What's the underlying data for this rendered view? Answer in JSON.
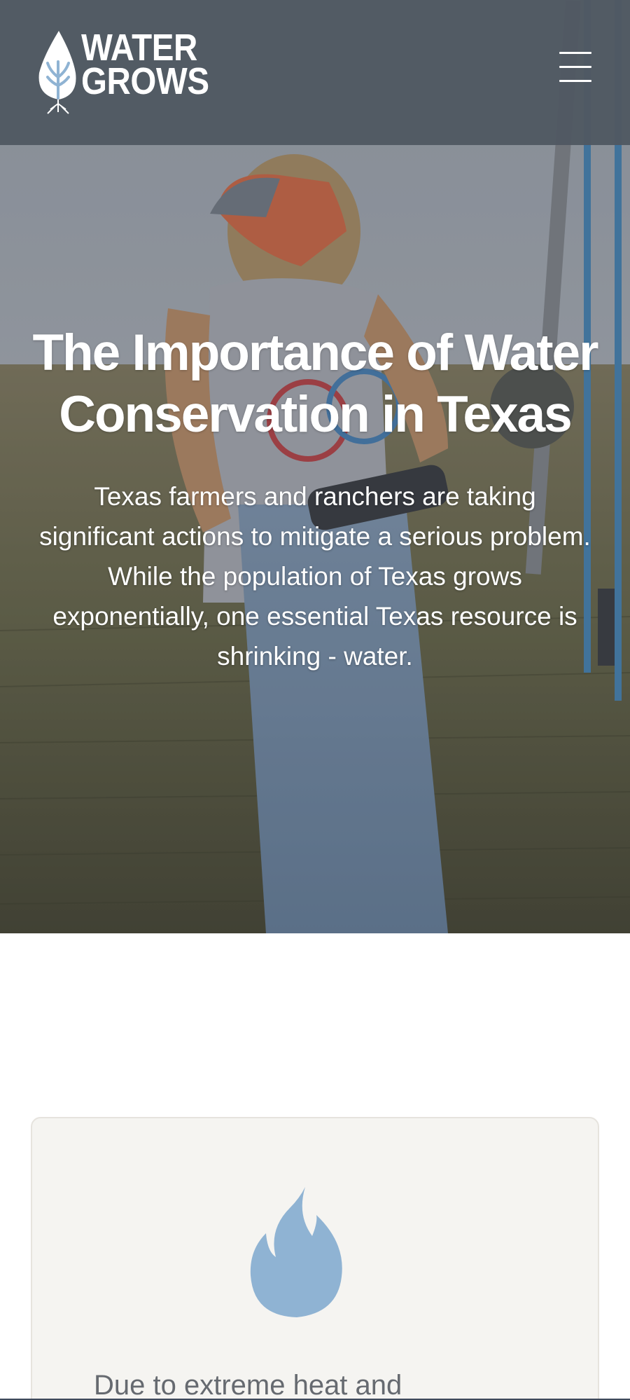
{
  "header": {
    "logo_line1": "WATER",
    "logo_line2": "GROWS",
    "menu_icon": "hamburger-menu-icon"
  },
  "hero": {
    "title": "The Importance of Water Conservation in Texas",
    "subtitle": "Texas farmers and ranchers are taking significant actions to mitigate a serious problem. While the population of Texas grows exponentially, one essential Texas resource is shrinking - water."
  },
  "card": {
    "icon": "flame-icon",
    "icon_color": "#8fb3d3",
    "text": "Due to extreme heat and"
  },
  "colors": {
    "header_bg": "#505862",
    "card_bg": "#f5f4f1",
    "accent_blue": "#8fb3d3"
  }
}
